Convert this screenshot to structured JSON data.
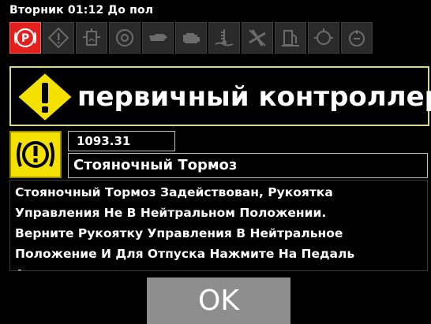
{
  "status": {
    "text": "Вторник 01:12 До пол"
  },
  "icons": [
    {
      "name": "parking-brake-icon",
      "active": true
    },
    {
      "name": "general-warning-icon",
      "active": false
    },
    {
      "name": "hydraulic-icon",
      "active": false
    },
    {
      "name": "transmission-icon",
      "active": false
    },
    {
      "name": "oil-icon",
      "active": false
    },
    {
      "name": "engine-icon",
      "active": false
    },
    {
      "name": "coolant-icon",
      "active": false
    },
    {
      "name": "fan-icon",
      "active": false
    },
    {
      "name": "fuel-level-icon",
      "active": false
    },
    {
      "name": "filter-icon",
      "active": false
    },
    {
      "name": "pto-icon",
      "active": false
    }
  ],
  "alert": {
    "title": "первичный контроллер",
    "code": "1093.31",
    "name": "Стояночный Тормоз",
    "message": " Стояночный Тормоз Задействован, Рукоятка\nУправления Не В Нейтральном Положении.\nВерните Рукоятку Управления В Нейтральное\nПоложение И Для Отпуска Нажмите На Педаль\nАкселератора"
  },
  "button": {
    "ok_label": "OK"
  },
  "colors": {
    "active_icon": "#e32020",
    "warning_yellow": "#f4e100",
    "button_gray": "#8e8e8e"
  }
}
